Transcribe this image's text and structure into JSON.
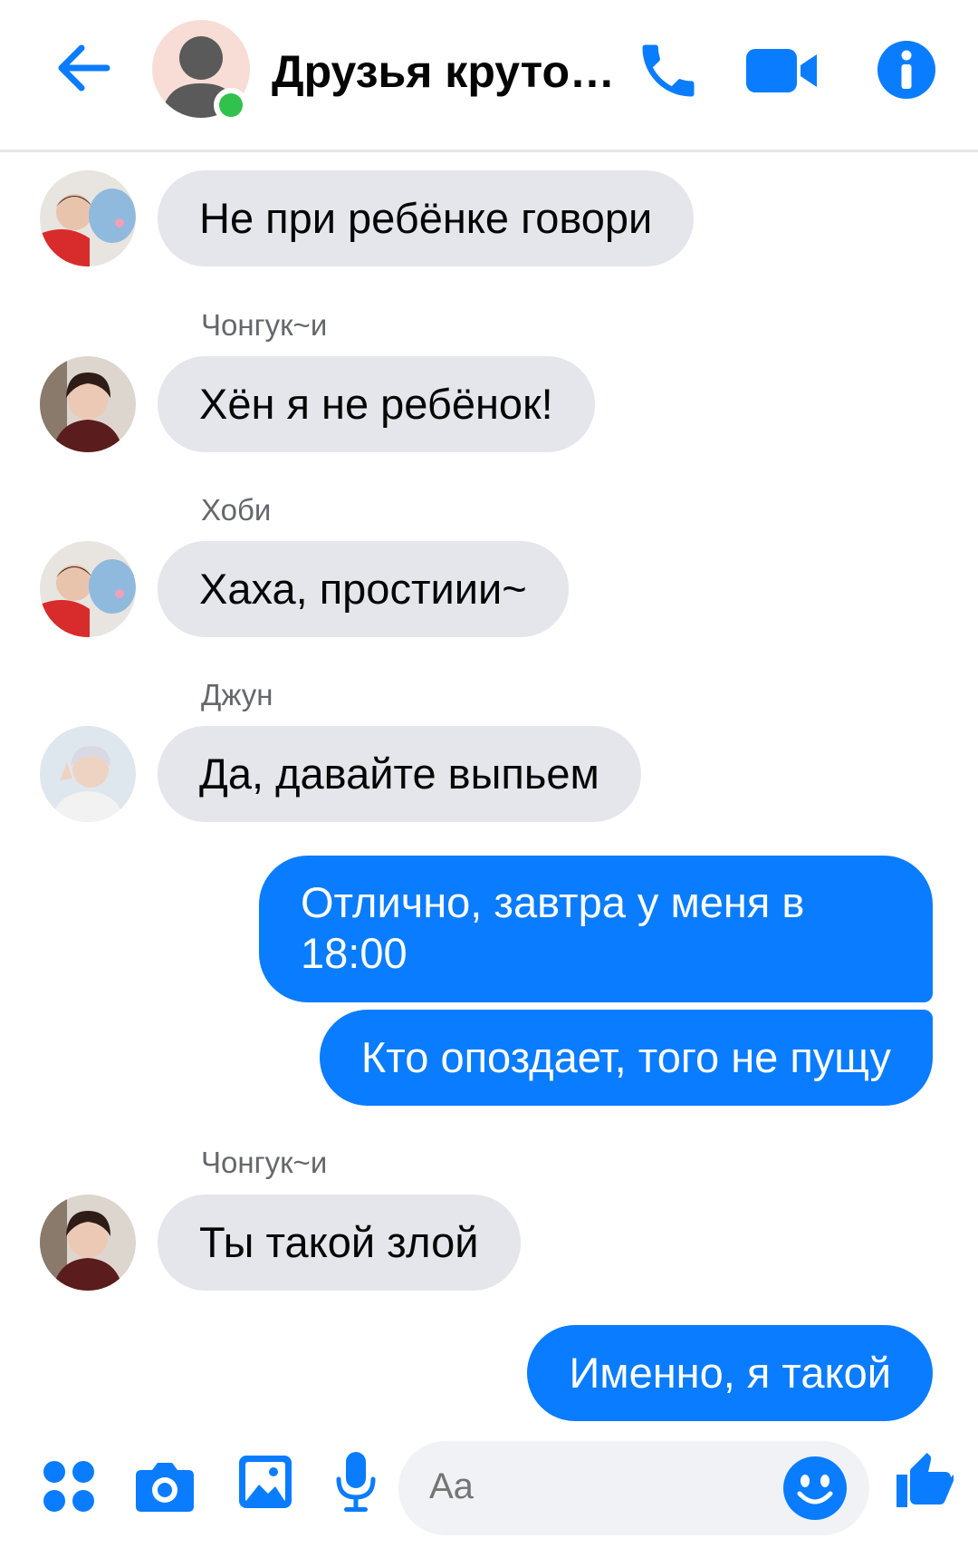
{
  "header": {
    "title": "Друзья круто…",
    "icons": [
      "back-arrow-icon",
      "phone-icon",
      "video-camera-icon",
      "info-icon"
    ]
  },
  "colors": {
    "accent": "#0a7cff",
    "incoming_bubble": "#e4e6eb",
    "online": "#31c24d",
    "muted_text": "#65676b"
  },
  "messages": [
    {
      "direction": "in",
      "sender": "",
      "text": "Не при ребёнке говори"
    },
    {
      "direction": "in",
      "sender": "Чонгук~и",
      "text": "Хён я не ребёнок!"
    },
    {
      "direction": "in",
      "sender": "Хоби",
      "text": "Хаха, простиии~"
    },
    {
      "direction": "in",
      "sender": "Джун",
      "text": "Да, давайте выпьем"
    },
    {
      "direction": "out",
      "sender": "",
      "text": "Отлично, завтра у меня в 18:00"
    },
    {
      "direction": "out",
      "sender": "",
      "text": "Кто опоздает, того не пущу"
    },
    {
      "direction": "in",
      "sender": "Чонгук~и",
      "text": "Ты такой злой"
    },
    {
      "direction": "out",
      "sender": "",
      "text": "Именно, я такой"
    }
  ],
  "composer": {
    "placeholder": "Aa",
    "icons": [
      "apps-menu-icon",
      "camera-icon",
      "gallery-icon",
      "microphone-icon",
      "emoji-icon",
      "thumbs-up-icon"
    ]
  }
}
